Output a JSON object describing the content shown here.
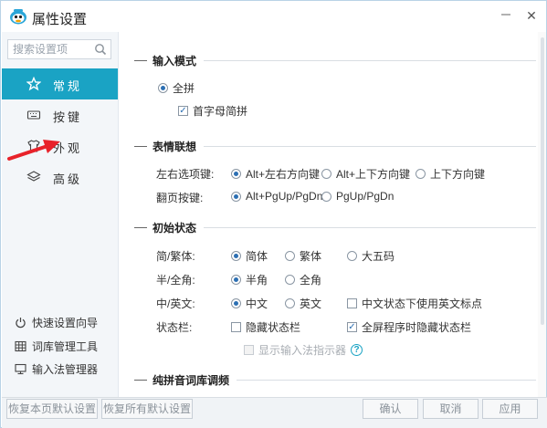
{
  "window": {
    "title": "属性设置",
    "close_glyph": "✕"
  },
  "sidebar": {
    "search_placeholder": "搜索设置项",
    "nav": [
      {
        "label": "常规",
        "icon": "star-icon"
      },
      {
        "label": "按键",
        "icon": "keyboard-icon"
      },
      {
        "label": "外观",
        "icon": "shirt-icon"
      },
      {
        "label": "高级",
        "icon": "layers-icon"
      }
    ],
    "links": [
      {
        "label": "快速设置向导",
        "icon": "power-icon"
      },
      {
        "label": "词库管理工具",
        "icon": "grid-icon"
      },
      {
        "label": "输入法管理器",
        "icon": "monitor-icon"
      }
    ]
  },
  "content": {
    "input_mode": {
      "title": "输入模式",
      "quanpin": "全拼",
      "shouzimu": "首字母简拼"
    },
    "emoji": {
      "title": "表情联想",
      "leftright_label": "左右选项键:",
      "leftright_opts": [
        "Alt+左右方向键",
        "Alt+上下方向键",
        "上下方向键"
      ],
      "page_label": "翻页按键:",
      "page_opts": [
        "Alt+PgUp/PgDn",
        "PgUp/PgDn"
      ]
    },
    "initial": {
      "title": "初始状态",
      "jianfan_label": "简/繁体:",
      "jianfan_opts": [
        "简体",
        "繁体",
        "大五码"
      ],
      "banquan_label": "半/全角:",
      "banquan_opts": [
        "半角",
        "全角"
      ],
      "zhongying_label": "中/英文:",
      "zhongying_opts": [
        "中文",
        "英文"
      ],
      "zhongying_check": "中文状态下使用英文标点",
      "status_label": "状态栏:",
      "hide_status": "隐藏状态栏",
      "fullscreen_hide": "全屏程序时隐藏状态栏",
      "show_indicator": "显示输入法指示器",
      "help_glyph": "?"
    },
    "pinyin": {
      "title": "纯拼音词库调频"
    }
  },
  "footer": {
    "restore_page": "恢复本页默认设置",
    "restore_all": "恢复所有默认设置",
    "ok": "确认",
    "cancel": "取消",
    "apply": "应用"
  },
  "colors": {
    "accent": "#1aa3c4",
    "annotation": "#e8222a"
  }
}
